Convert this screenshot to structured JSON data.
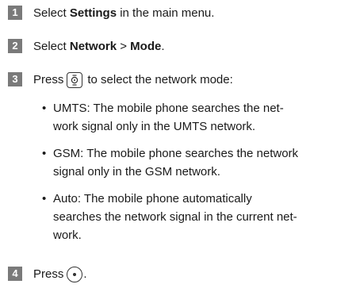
{
  "steps": [
    {
      "number": "1",
      "pre": "Select ",
      "bold": "Settings",
      "post": " in the main menu."
    },
    {
      "number": "2",
      "pre": "Select ",
      "bold": "Network",
      "mid": " > ",
      "bold2": "Mode",
      "post": "."
    },
    {
      "number": "3",
      "pre": "Press",
      "icon": "navigation-key-icon",
      "post": "to select the network mode:"
    },
    {
      "number": "4",
      "pre": "Press",
      "icon": "ok-key-icon",
      "post": "."
    }
  ],
  "bullets": [
    {
      "lines": [
        "UMTS: The mobile phone searches the net-",
        "work signal only in the UMTS network."
      ]
    },
    {
      "lines": [
        "GSM: The mobile phone searches the network",
        "signal only in the GSM network."
      ]
    },
    {
      "lines": [
        "Auto: The mobile phone automatically",
        "searches the network signal in the current net-",
        "work."
      ]
    }
  ],
  "bullet_mark": "•"
}
